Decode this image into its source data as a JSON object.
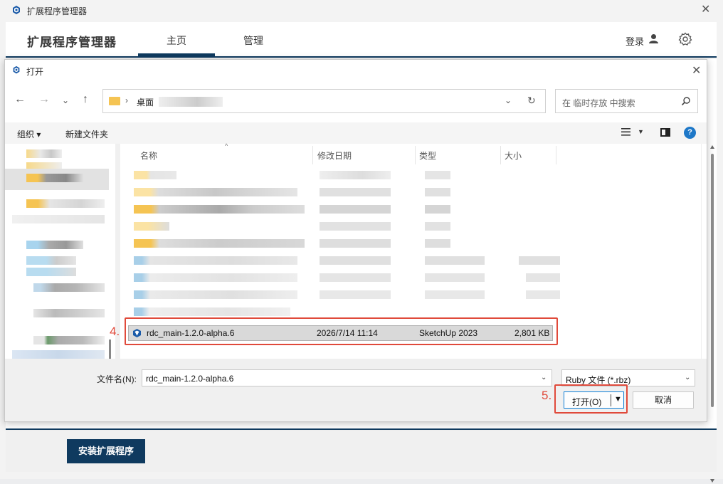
{
  "extension_manager": {
    "window_title": "扩展程序管理器",
    "header_title": "扩展程序管理器",
    "tabs": [
      {
        "label": "主页"
      },
      {
        "label": "管理"
      }
    ],
    "login_label": "登录",
    "install_button": "安装扩展程序",
    "accent_color": "#0f3a5f"
  },
  "dialog": {
    "title": "打开",
    "breadcrumb": [
      "桌面"
    ],
    "search_placeholder": "在 临时存放 中搜索",
    "toolbar": {
      "organize": "组织",
      "new_folder": "新建文件夹"
    },
    "columns": [
      "名称",
      "修改日期",
      "类型",
      "大小"
    ],
    "selected_file": {
      "name": "rdc_main-1.2.0-alpha.6",
      "modified": "2026/7/14 11:14",
      "type": "SketchUp 2023",
      "size": "2,801 KB"
    },
    "filename_label": "文件名(N):",
    "filename_value": "rdc_main-1.2.0-alpha.6",
    "filetype_value": "Ruby 文件 (*.rbz)",
    "open_button": "打开(O)",
    "cancel_button": "取消"
  },
  "annotations": [
    {
      "label": "4."
    },
    {
      "label": "5."
    }
  ],
  "colors": {
    "annotation": "#e04a3b",
    "selection_border": "#0f7fd6"
  }
}
